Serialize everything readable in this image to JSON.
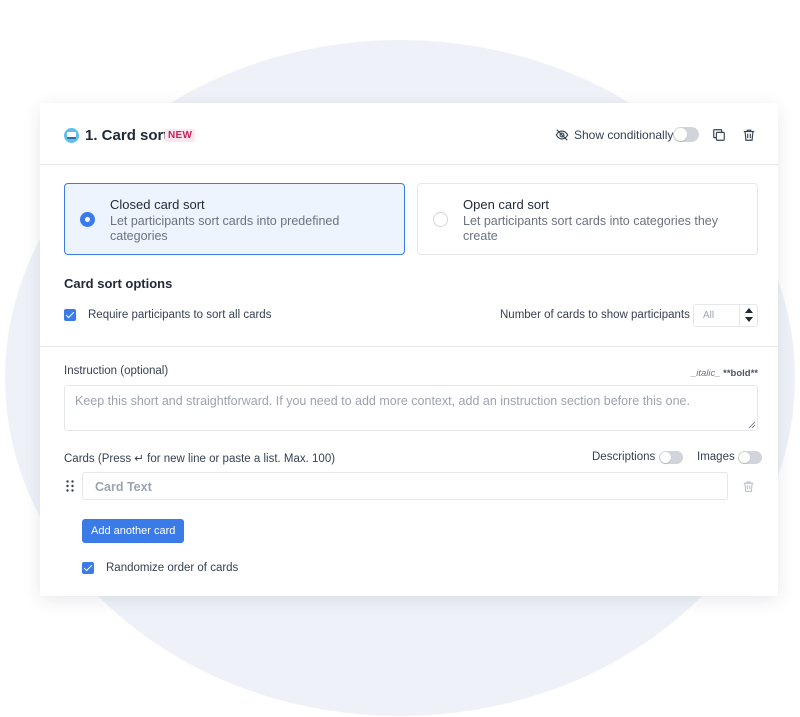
{
  "block": {
    "title": "1. Card sort",
    "badge": "NEW",
    "show_conditionally_label": "Show conditionally"
  },
  "sort_options": [
    {
      "title": "Closed card sort",
      "description": "Let participants sort cards into predefined categories",
      "selected": true
    },
    {
      "title": "Open card sort",
      "description": "Let participants sort cards into categories they create",
      "selected": false
    }
  ],
  "options": {
    "section_title": "Card sort options",
    "require_all_label": "Require participants to sort all cards",
    "require_all_checked": true,
    "num_cards_label": "Number of cards to show participants",
    "num_cards_value": "All"
  },
  "instruction": {
    "label": "Instruction (optional)",
    "hint_italic": "_italic_",
    "hint_bold": "**bold**",
    "placeholder": "Keep this short and straightforward. If you need to add more context, add an instruction section before this one."
  },
  "cards": {
    "label": "Cards (Press ↵ for new line or paste a list. Max. 100)",
    "descriptions_label": "Descriptions",
    "images_label": "Images",
    "card_placeholder": "Card Text",
    "add_button_label": "Add another card",
    "randomize_label": "Randomize order of cards",
    "randomize_checked": true
  },
  "colors": {
    "accent": "#3b7be8",
    "badge_text": "#c0265b",
    "badge_bg": "#fde7ef",
    "background_blob": "#eef2f8"
  }
}
